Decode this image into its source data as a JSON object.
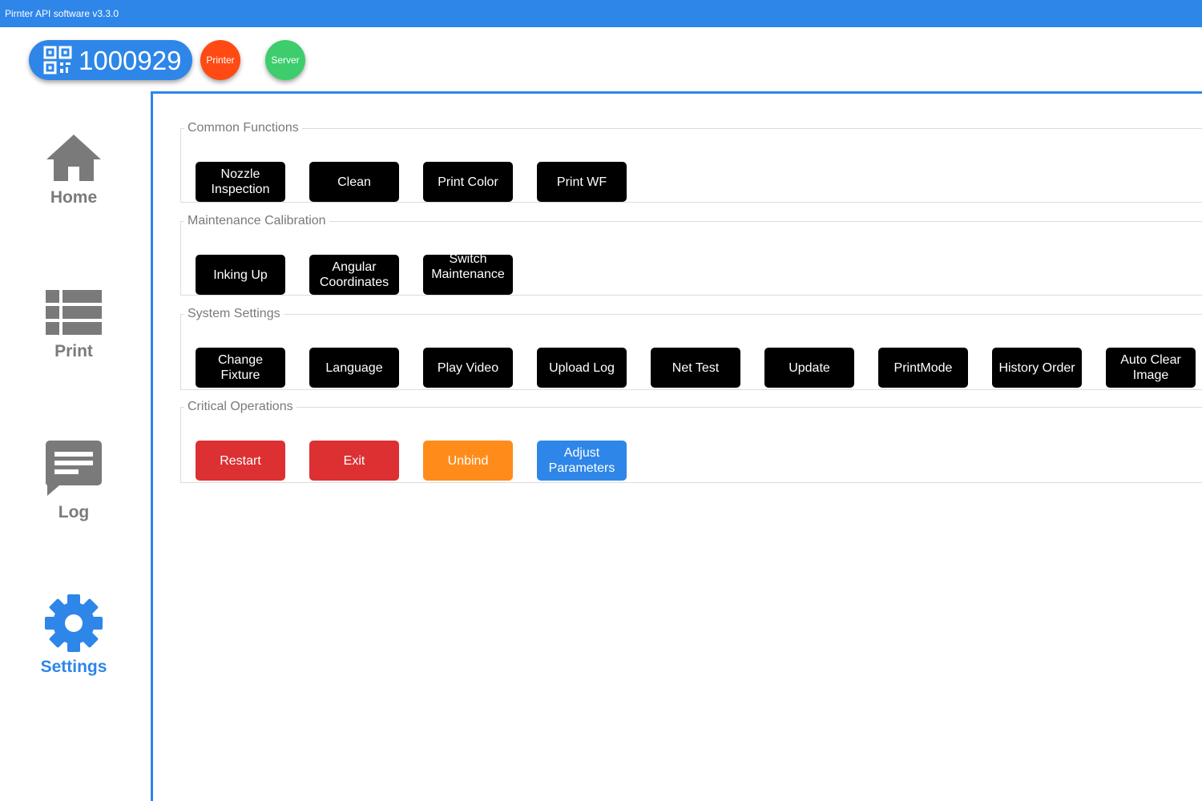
{
  "window": {
    "title": "Pirnter API software v3.3.0"
  },
  "header": {
    "device_id": "1000929",
    "printer_status": "Printer",
    "server_status": "Server",
    "colors": {
      "accent": "#2e86e8",
      "printer": "#ff4b13",
      "server": "#3dcd6d"
    }
  },
  "sidebar": {
    "items": [
      {
        "label": "Home",
        "icon": "home-icon"
      },
      {
        "label": "Print",
        "icon": "list-icon"
      },
      {
        "label": "Log",
        "icon": "chat-icon"
      },
      {
        "label": "Settings",
        "icon": "gear-icon",
        "active": true
      }
    ]
  },
  "groups": {
    "common": {
      "legend": "Common Functions",
      "buttons": [
        "Nozzle Inspection",
        "Clean",
        "Print Color",
        "Print WF"
      ]
    },
    "maintenance": {
      "legend": "Maintenance  Calibration",
      "buttons": [
        "Inking Up",
        "Angular Coordinates",
        "Switch Maintenance"
      ]
    },
    "system": {
      "legend": "System Settings",
      "buttons": [
        "Change Fixture",
        "Language",
        "Play Video",
        "Upload Log",
        "Net Test",
        "Update",
        "PrintMode",
        "History Order",
        "Auto Clear Image"
      ]
    },
    "critical": {
      "legend": "Critical Operations",
      "buttons": [
        "Restart",
        "Exit",
        "Unbind",
        "Adjust Parameters"
      ],
      "colors": {
        "danger": "#dc3033",
        "warning": "#ff8c1a",
        "primary": "#2e86e8"
      }
    }
  }
}
